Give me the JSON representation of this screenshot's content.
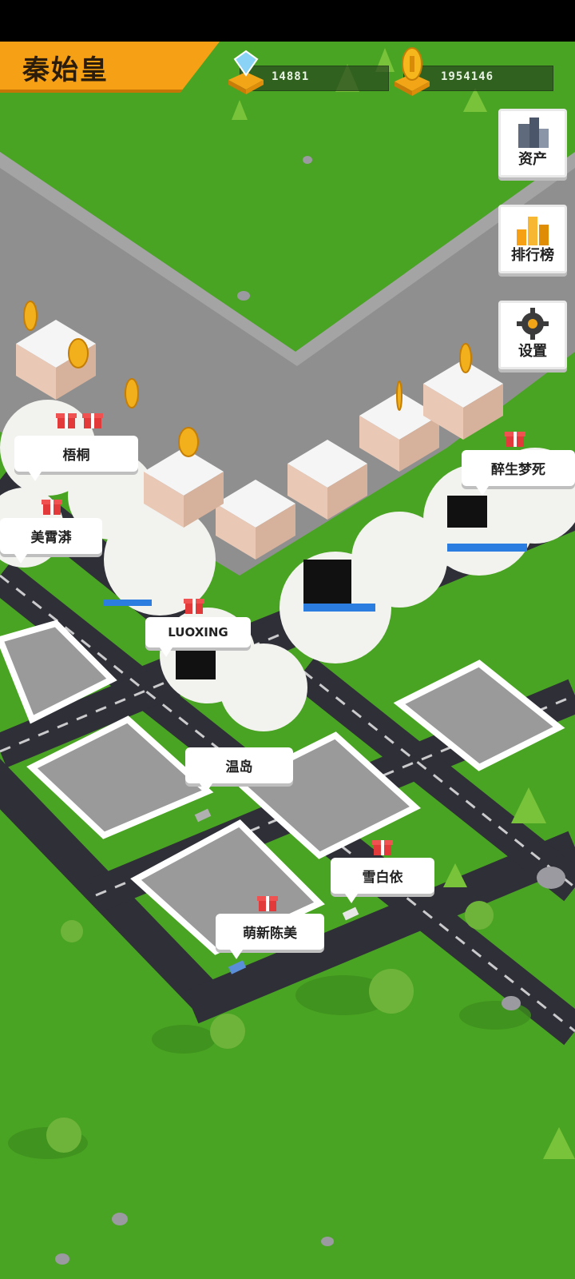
{
  "player": {
    "name": "秦始皇"
  },
  "resources": {
    "diamond": {
      "icon": "diamond-icon",
      "value": "14881"
    },
    "gold": {
      "icon": "gold-coin-icon",
      "value": "1954146"
    }
  },
  "side_buttons": {
    "assets": {
      "label": "资产",
      "icon": "assets-buildings-icon"
    },
    "ranking": {
      "label": "排行榜",
      "icon": "ranking-bars-icon"
    },
    "settings": {
      "label": "设置",
      "icon": "gear-icon"
    }
  },
  "bubbles": [
    {
      "text": "梧桐"
    },
    {
      "text": "美霄漭"
    },
    {
      "text": "醉生梦死"
    },
    {
      "text": "LUOXING"
    },
    {
      "text": "温岛"
    },
    {
      "text": "雪白依"
    },
    {
      "text": "萌新陈美"
    }
  ],
  "colors": {
    "grass": "#4aa423",
    "road": "#3c3c46",
    "banner": "#f5a015",
    "lot": "#9a9a9a"
  }
}
